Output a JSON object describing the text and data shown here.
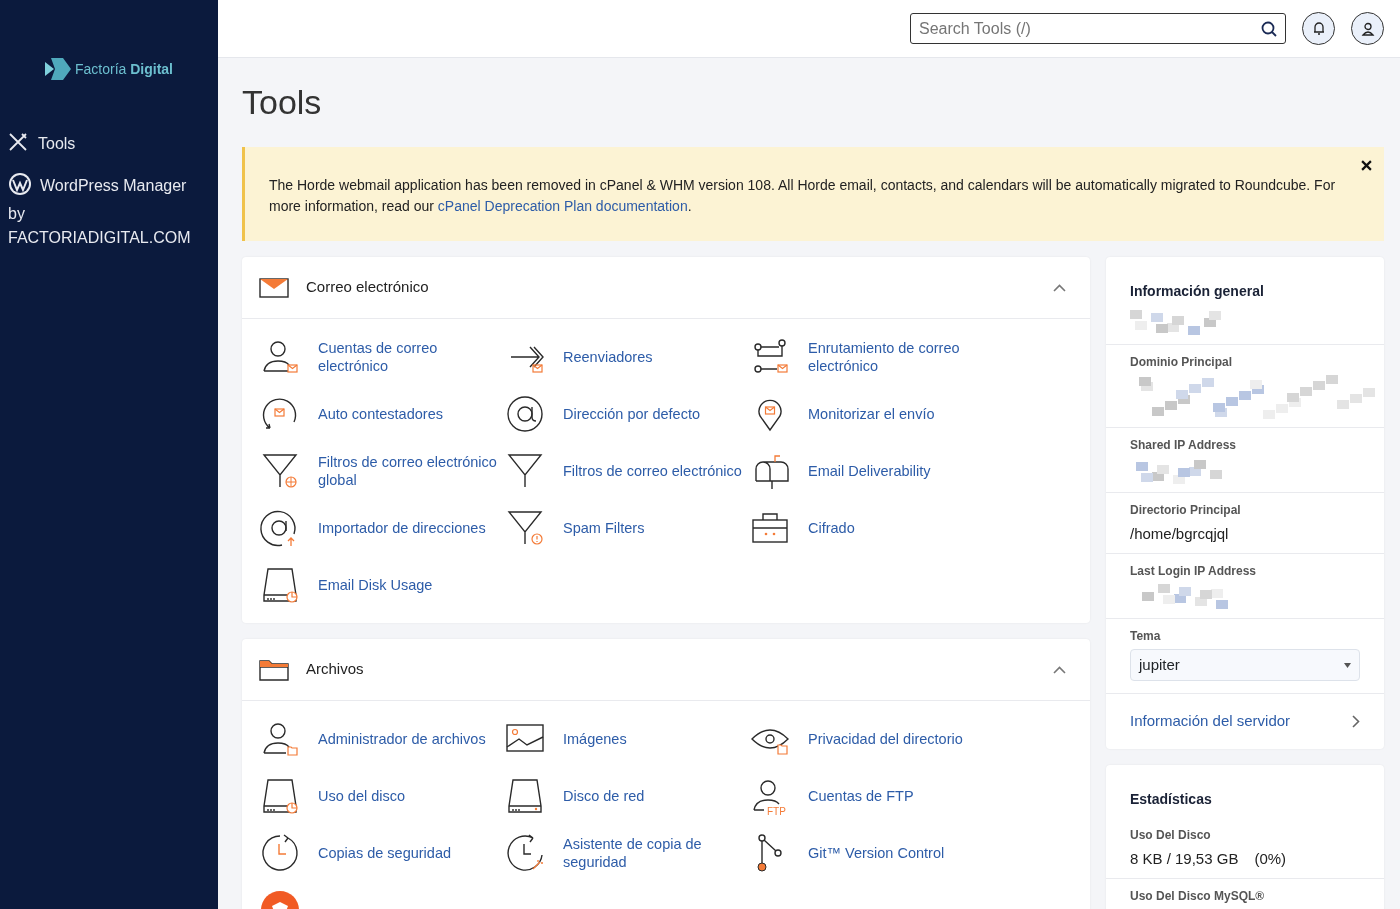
{
  "sidebar": {
    "logo": "Factoría **Digital**",
    "items": [
      {
        "kind": "tools",
        "label": "Tools"
      },
      {
        "kind": "wordpress",
        "label": "WordPress Manager",
        "suffix": "by FACTORIADIGITAL.COM"
      }
    ]
  },
  "header": {
    "search": {
      "placeholder": "Search Tools (/)"
    }
  },
  "page_title": "Tools",
  "notice": {
    "text": "The Horde webmail application has been removed in cPanel & WHM version 108. All Horde email, contacts, and calendars will be automatically migrated to Roundcube. For more information, read our ",
    "link": "cPanel Deprecation Plan documentation",
    "after": "."
  },
  "sections": [
    {
      "title": "Correo electrónico",
      "kind": "envelope",
      "expanded": true,
      "items": [
        {
          "kind": "user-mail",
          "label": "Cuentas de correo electrónico"
        },
        {
          "kind": "arrow-mail",
          "label": "Reenviadores"
        },
        {
          "kind": "routing",
          "label": "Enrutamiento de correo electrónico"
        },
        {
          "kind": "circle-mail",
          "label": "Auto contestadores"
        },
        {
          "kind": "at",
          "label": "Dirección por defecto"
        },
        {
          "kind": "pin",
          "label": "Monitorizar el envío"
        },
        {
          "kind": "funnel-globe",
          "label": "Filtros de correo electrónico global"
        },
        {
          "kind": "funnel",
          "label": "Filtros de correo electrónico"
        },
        {
          "kind": "mailbox",
          "label": "Email Deliverability"
        },
        {
          "kind": "at-up",
          "label": "Importador de direcciones"
        },
        {
          "kind": "funnel-alert",
          "label": "Spam Filters"
        },
        {
          "kind": "case",
          "label": "Cifrado"
        },
        {
          "kind": "disk-chart",
          "label": "Email Disk Usage"
        }
      ]
    },
    {
      "title": "Archivos",
      "kind": "folder",
      "expanded": true,
      "items": [
        {
          "kind": "user-folder",
          "label": "Administrador de archivos"
        },
        {
          "kind": "image",
          "label": "Imágenes"
        },
        {
          "kind": "eye",
          "label": "Privacidad del directorio"
        },
        {
          "kind": "disk-chart",
          "label": "Uso del disco"
        },
        {
          "kind": "disk",
          "label": "Disco de red"
        },
        {
          "kind": "user-ftp",
          "label": "Cuentas de FTP",
          "icon_text": "FTP"
        },
        {
          "kind": "clock",
          "label": "Copias de seguridad"
        },
        {
          "kind": "clock-wand",
          "label": "Asistente de copia de seguridad"
        },
        {
          "kind": "git",
          "label": "Git™ Version Control"
        },
        {
          "kind": "badge"
        }
      ]
    }
  ],
  "general_info": {
    "title": "Información general",
    "rows": [
      {
        "kind": "redacted",
        "label": ""
      },
      {
        "kind": "redacted",
        "label": "Dominio Principal"
      },
      {
        "kind": "redacted",
        "label": "Shared IP Address"
      },
      {
        "kind": "text",
        "label": "Directorio Principal",
        "value": "/home/bgrcqjql"
      },
      {
        "kind": "redacted",
        "label": "Last Login IP Address"
      },
      {
        "kind": "select",
        "label": "Tema",
        "value": "jupiter"
      },
      {
        "kind": "link",
        "label": "Información del servidor"
      }
    ]
  },
  "statistics": {
    "title": "Estadísticas",
    "rows": [
      {
        "label": "Uso Del Disco",
        "value": "8 KB / 19,53 GB",
        "percent": "(0%)"
      },
      {
        "label": "Uso Del Disco MySQL®"
      }
    ]
  }
}
